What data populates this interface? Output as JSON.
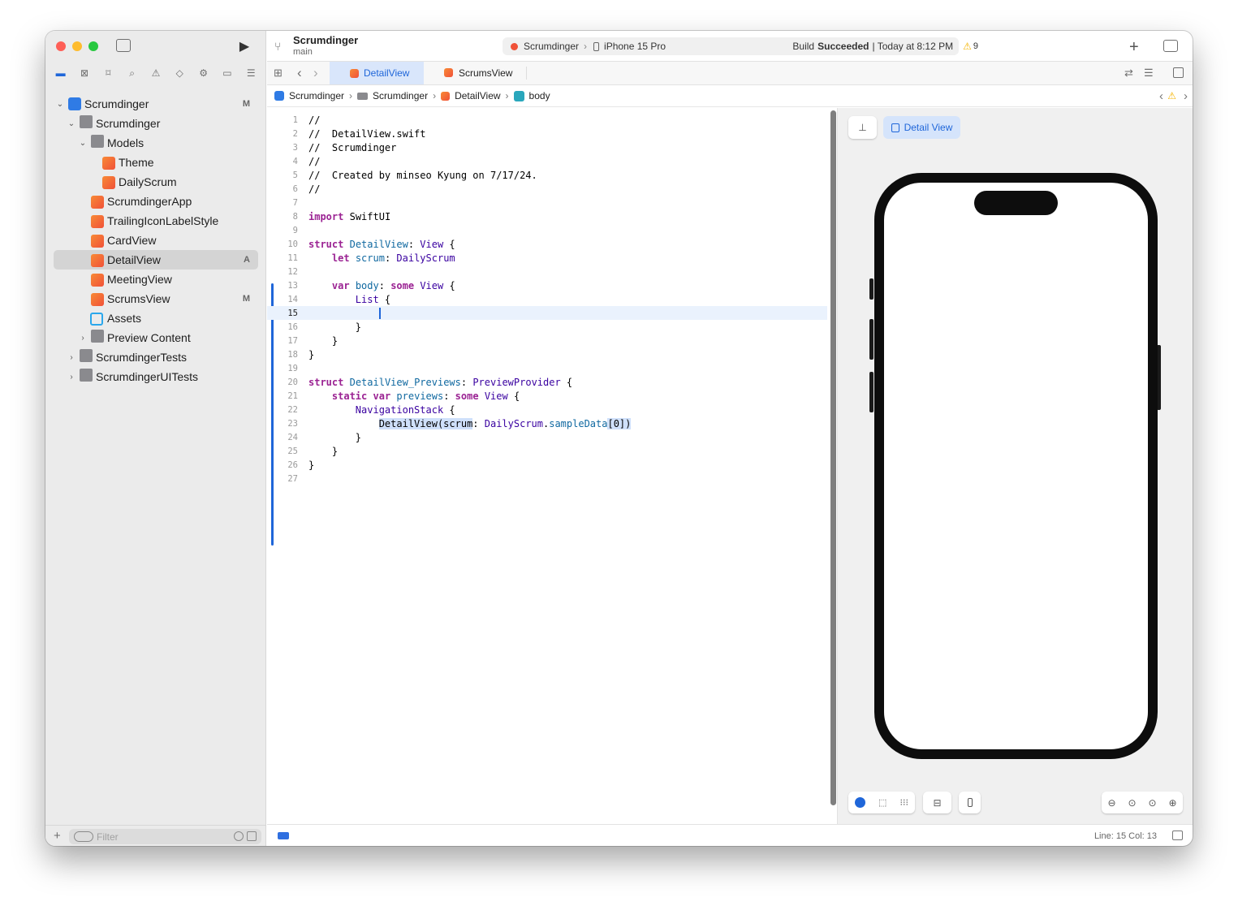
{
  "toolbar": {
    "project": "Scrumdinger",
    "branch": "main",
    "scheme": "Scrumdinger",
    "device": "iPhone 15 Pro",
    "build_status_prefix": "Build",
    "build_status": "Succeeded",
    "build_time": "| Today at 8:12 PM",
    "warning_count": "9"
  },
  "tabs": [
    {
      "label": "DetailView"
    },
    {
      "label": "ScrumsView"
    }
  ],
  "breadcrumb": [
    "Scrumdinger",
    "Scrumdinger",
    "DetailView",
    "body"
  ],
  "navigator": {
    "items": [
      {
        "label": "Scrumdinger",
        "badge": "M"
      },
      {
        "label": "Scrumdinger"
      },
      {
        "label": "Models"
      },
      {
        "label": "Theme"
      },
      {
        "label": "DailyScrum"
      },
      {
        "label": "ScrumdingerApp"
      },
      {
        "label": "TrailingIconLabelStyle"
      },
      {
        "label": "CardView"
      },
      {
        "label": "DetailView",
        "badge": "A"
      },
      {
        "label": "MeetingView"
      },
      {
        "label": "ScrumsView",
        "badge": "M"
      },
      {
        "label": "Assets"
      },
      {
        "label": "Preview Content"
      },
      {
        "label": "ScrumdingerTests"
      },
      {
        "label": "ScrumdingerUITests"
      }
    ],
    "filter_placeholder": "Filter"
  },
  "code": {
    "line_numbers": [
      "1",
      "2",
      "3",
      "4",
      "5",
      "6",
      "7",
      "8",
      "9",
      "10",
      "11",
      "12",
      "13",
      "14",
      "15",
      "16",
      "17",
      "18",
      "19",
      "20",
      "21",
      "22",
      "23",
      "24",
      "25",
      "26",
      "27"
    ],
    "comments": [
      "//",
      "//  DetailView.swift",
      "//  Scrumdinger",
      "//",
      "//  Created by minseo Kyung on 7/17/24.",
      "//"
    ],
    "kw_import": "import",
    "kw_struct": "struct",
    "kw_let": "let",
    "kw_var": "var",
    "kw_some": "some",
    "kw_static": "static",
    "swiftui": "SwiftUI",
    "detailview": "DetailView",
    "detailview_previews": "DetailView_Previews",
    "view": "View",
    "previewprovider": "PreviewProvider",
    "scrum": "scrum",
    "dailyscrum": "DailyScrum",
    "body": "body",
    "list": "List",
    "previews": "previews",
    "navigationstack": "NavigationStack",
    "sampledata": "sampleData",
    "brace_open": " {",
    "brace_close": "}",
    "colon": ": ",
    "call_open": "DetailView(scrum",
    "index": "[0])"
  },
  "canvas": {
    "preview_label": "Detail View"
  },
  "status": {
    "position": "Line: 15  Col: 13"
  }
}
